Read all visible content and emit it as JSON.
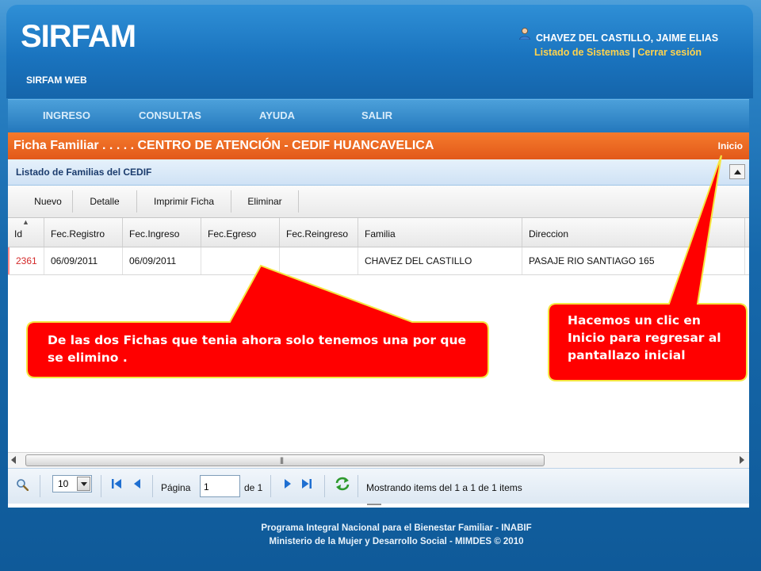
{
  "header": {
    "logo": "SIRFAM",
    "subtitle": "SIRFAM WEB",
    "user_name": "CHAVEZ DEL CASTILLO, JAIME ELIAS",
    "link_systems": "Listado de Sistemas",
    "link_separator": "|",
    "link_logout": "Cerrar sesión"
  },
  "menu": [
    "INGRESO",
    "CONSULTAS",
    "AYUDA",
    "SALIR"
  ],
  "panel": {
    "title": "Ficha Familiar . . . . . CENTRO DE ATENCIÓN - CEDIF HUANCAVELICA",
    "home_link": "Inicio",
    "grid_title": "Listado de Familias del CEDIF"
  },
  "toolbar": [
    "Nuevo",
    "Detalle",
    "Imprimir Ficha",
    "Eliminar"
  ],
  "table": {
    "columns": [
      "Id",
      "Fec.Registro",
      "Fec.Ingreso",
      "Fec.Egreso",
      "Fec.Reingreso",
      "Familia",
      "Direccion"
    ],
    "rows": [
      [
        "2361",
        "06/09/2011",
        "06/09/2011",
        "",
        "",
        "CHAVEZ DEL CASTILLO",
        "PASAJE RIO SANTIAGO 165"
      ]
    ]
  },
  "pager": {
    "page_size": "10",
    "page_label": "Página",
    "page_value": "1",
    "of_label": "de 1",
    "status": "Mostrando items del 1 a 1 de 1 items"
  },
  "footer": {
    "line1": "Programa Integral Nacional para el Bienestar Familiar - INABIF",
    "line2": "Ministerio de la Mujer y Desarrollo Social - MIMDES © 2010"
  },
  "callouts": {
    "left": "De las dos Fichas que tenia ahora solo tenemos una por que se elimino .",
    "right": "Hacemos un clic en Inicio para regresar al pantallazo inicial"
  },
  "colors": {
    "brand_blue": "#1468a8",
    "orange_bar": "#e8601f",
    "callout_red": "#ff0000",
    "callout_border": "#f5e642",
    "link_yellow": "#ffd34d"
  }
}
